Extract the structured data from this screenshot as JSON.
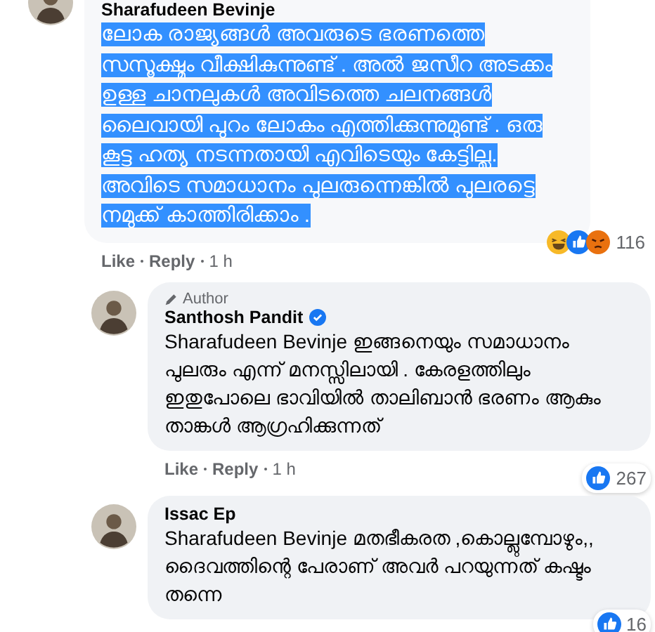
{
  "comments": [
    {
      "author": "Sharafudeen Bevinje",
      "text_selected": true,
      "text": "ലോക രാജ്യങ്ങൾ അവരുടെ ഭരണത്തെ സസൂക്ഷ്മം വീക്ഷികുന്നുണ്ട് . അൽ ജസീറ അടക്കം ഉള്ള ചാനലുകൾ അവിടത്തെ ചലനങ്ങൾ ലൈവായി പുറം ലോകം എത്തിക്കുന്നുമുണ്ട് . ഒരു കൂട്ട ഹത്യ നടന്നതായി എവിടെയും കേട്ടില്ല. അവിടെ സമാധാനം പുലരുന്നെങ്കിൽ പുലരട്ടെ നമുക്ക് കാത്തിരിക്കാം .",
      "reactions": [
        {
          "kind": "haha"
        },
        {
          "kind": "like"
        },
        {
          "kind": "angry"
        }
      ],
      "reaction_count": "116",
      "actions": [
        "Like",
        "Reply",
        "1 h"
      ],
      "replies": [
        {
          "author": "Santhosh Pandit",
          "badge": "Author",
          "verified": true,
          "text_selected": false,
          "text": "Sharafudeen Bevinje ഇങ്ങനെയും സമാധാനം പുലരും എന്ന് മനസ്സിലായി . കേരളത്തിലും ഇതുപോലെ ഭാവിയിൽ താലിബാൻ ഭരണം ആകും താങ്കൾ ആഗ്രഹിക്കുന്നത്",
          "reactions": [
            {
              "kind": "like"
            }
          ],
          "reaction_count": "267",
          "actions": [
            "Like",
            "Reply",
            "1 h"
          ]
        },
        {
          "author": "Issac Ep",
          "text_selected": false,
          "text": "Sharafudeen Bevinje മതഭീകരത ,കൊല്ലുമ്പോഴും,, ദൈവത്തിന്റെ പേരാണ് അവർ പറയുന്നത് കഷ്ടം തന്നെ",
          "reactions": [
            {
              "kind": "like"
            }
          ],
          "reaction_count": "16"
        }
      ]
    }
  ]
}
